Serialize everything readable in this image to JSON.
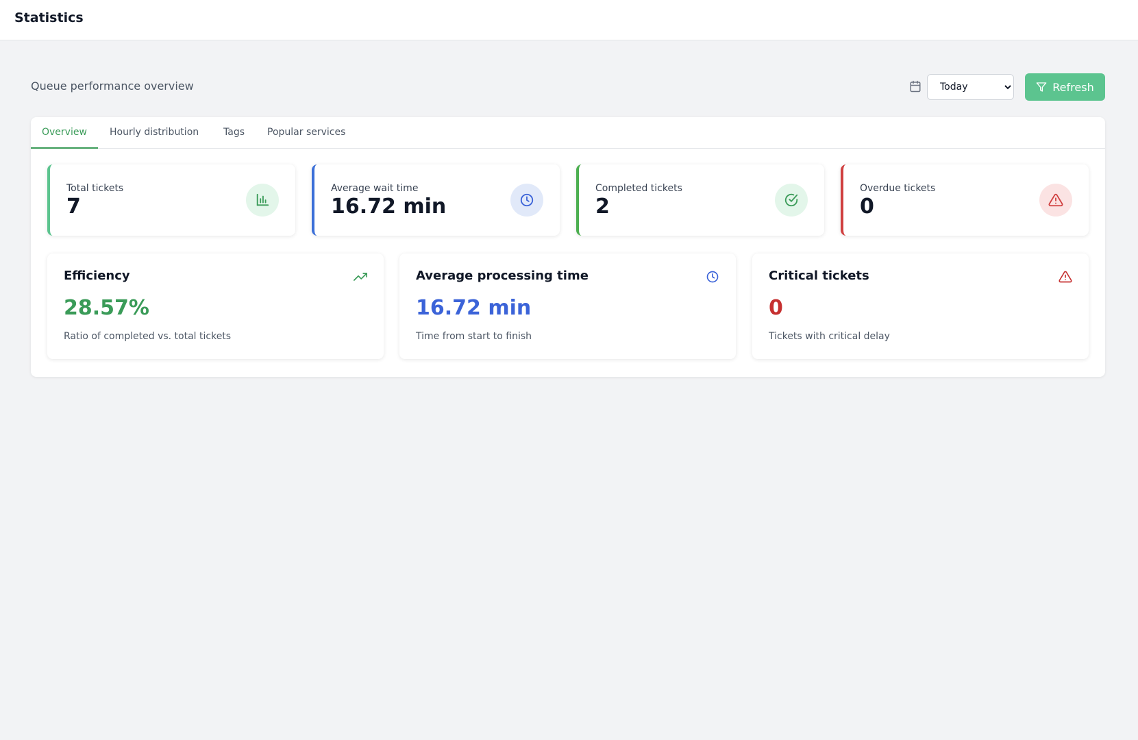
{
  "header": {
    "title": "Statistics"
  },
  "toolbar": {
    "subtitle": "Queue performance overview",
    "period_selected": "Today",
    "period_options": [
      "Today"
    ],
    "refresh_label": "Refresh"
  },
  "tabs": [
    {
      "label": "Overview",
      "active": true
    },
    {
      "label": "Hourly distribution",
      "active": false
    },
    {
      "label": "Tags",
      "active": false
    },
    {
      "label": "Popular services",
      "active": false
    }
  ],
  "stats": [
    {
      "label": "Total tickets",
      "value": "7",
      "icon": "bar-chart-icon",
      "color": "#5cc48f"
    },
    {
      "label": "Average wait time",
      "value": "16.72 min",
      "icon": "clock-icon",
      "color": "#3b6fd8"
    },
    {
      "label": "Completed tickets",
      "value": "2",
      "icon": "check-circle-icon",
      "color": "#4caf50"
    },
    {
      "label": "Overdue tickets",
      "value": "0",
      "icon": "warning-icon",
      "color": "#d04040"
    }
  ],
  "details": [
    {
      "title": "Efficiency",
      "value": "28.57%",
      "description": "Ratio of completed vs. total tickets",
      "icon": "trending-up-icon",
      "color": "#3a9b58"
    },
    {
      "title": "Average processing time",
      "value": "16.72 min",
      "description": "Time from start to finish",
      "icon": "clock-icon",
      "color": "#3b63d8"
    },
    {
      "title": "Critical tickets",
      "value": "0",
      "description": "Tickets with critical delay",
      "icon": "warning-icon",
      "color": "#c63030"
    }
  ]
}
